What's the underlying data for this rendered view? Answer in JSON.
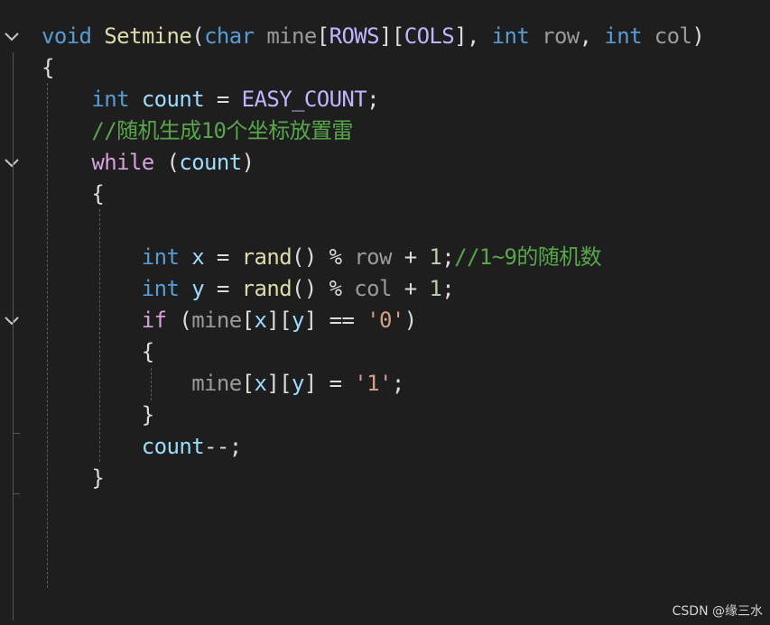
{
  "colors": {
    "background": "#1e1e1e",
    "keyword": "#569cd6",
    "control": "#d8a0df",
    "function": "#dcdcaa",
    "macro": "#beb7ff",
    "variable": "#9cdcfe",
    "comment": "#57a64a",
    "string": "#d69d85",
    "number": "#b5cea8",
    "plain": "#dcdcdc",
    "param": "#9a9a9a"
  },
  "code_lines": [
    {
      "tokens": [
        {
          "t": "void",
          "c": "keyword"
        },
        {
          "t": " ",
          "c": "plain"
        },
        {
          "t": "Setmine",
          "c": "function"
        },
        {
          "t": "(",
          "c": "plain"
        },
        {
          "t": "char",
          "c": "keyword"
        },
        {
          "t": " ",
          "c": "plain"
        },
        {
          "t": "mine",
          "c": "param"
        },
        {
          "t": "[",
          "c": "plain"
        },
        {
          "t": "ROWS",
          "c": "macro"
        },
        {
          "t": "][",
          "c": "plain"
        },
        {
          "t": "COLS",
          "c": "macro"
        },
        {
          "t": "], ",
          "c": "plain"
        },
        {
          "t": "int",
          "c": "keyword"
        },
        {
          "t": " ",
          "c": "plain"
        },
        {
          "t": "row",
          "c": "param"
        },
        {
          "t": ", ",
          "c": "plain"
        },
        {
          "t": "int",
          "c": "keyword"
        },
        {
          "t": " ",
          "c": "plain"
        },
        {
          "t": "col",
          "c": "param"
        },
        {
          "t": ")",
          "c": "plain"
        }
      ]
    },
    {
      "tokens": [
        {
          "t": "{",
          "c": "plain"
        }
      ]
    },
    {
      "tokens": [
        {
          "t": "    ",
          "c": "plain"
        },
        {
          "t": "int",
          "c": "keyword"
        },
        {
          "t": " ",
          "c": "plain"
        },
        {
          "t": "count",
          "c": "variable"
        },
        {
          "t": " = ",
          "c": "plain"
        },
        {
          "t": "EASY_COUNT",
          "c": "macro"
        },
        {
          "t": ";",
          "c": "plain"
        }
      ]
    },
    {
      "tokens": [
        {
          "t": "    ",
          "c": "plain"
        },
        {
          "t": "//随机生成10个坐标放置雷",
          "c": "comment"
        }
      ]
    },
    {
      "tokens": [
        {
          "t": "    ",
          "c": "plain"
        },
        {
          "t": "while",
          "c": "control"
        },
        {
          "t": " (",
          "c": "plain"
        },
        {
          "t": "count",
          "c": "variable"
        },
        {
          "t": ")",
          "c": "plain"
        }
      ]
    },
    {
      "tokens": [
        {
          "t": "    {",
          "c": "plain"
        }
      ]
    },
    {
      "tokens": []
    },
    {
      "tokens": [
        {
          "t": "        ",
          "c": "plain"
        },
        {
          "t": "int",
          "c": "keyword"
        },
        {
          "t": " ",
          "c": "plain"
        },
        {
          "t": "x",
          "c": "variable"
        },
        {
          "t": " = ",
          "c": "plain"
        },
        {
          "t": "rand",
          "c": "function"
        },
        {
          "t": "() % ",
          "c": "plain"
        },
        {
          "t": "row",
          "c": "param"
        },
        {
          "t": " + ",
          "c": "plain"
        },
        {
          "t": "1",
          "c": "number"
        },
        {
          "t": ";",
          "c": "plain"
        },
        {
          "t": "//1~9的随机数",
          "c": "comment"
        }
      ]
    },
    {
      "tokens": [
        {
          "t": "        ",
          "c": "plain"
        },
        {
          "t": "int",
          "c": "keyword"
        },
        {
          "t": " ",
          "c": "plain"
        },
        {
          "t": "y",
          "c": "variable"
        },
        {
          "t": " = ",
          "c": "plain"
        },
        {
          "t": "rand",
          "c": "function"
        },
        {
          "t": "() % ",
          "c": "plain"
        },
        {
          "t": "col",
          "c": "param"
        },
        {
          "t": " + ",
          "c": "plain"
        },
        {
          "t": "1",
          "c": "number"
        },
        {
          "t": ";",
          "c": "plain"
        }
      ]
    },
    {
      "tokens": [
        {
          "t": "        ",
          "c": "plain"
        },
        {
          "t": "if",
          "c": "control"
        },
        {
          "t": " (",
          "c": "plain"
        },
        {
          "t": "mine",
          "c": "param"
        },
        {
          "t": "[",
          "c": "plain"
        },
        {
          "t": "x",
          "c": "variable"
        },
        {
          "t": "][",
          "c": "plain"
        },
        {
          "t": "y",
          "c": "variable"
        },
        {
          "t": "] == ",
          "c": "plain"
        },
        {
          "t": "'0'",
          "c": "string"
        },
        {
          "t": ")",
          "c": "plain"
        }
      ]
    },
    {
      "tokens": [
        {
          "t": "        {",
          "c": "plain"
        }
      ]
    },
    {
      "tokens": [
        {
          "t": "            ",
          "c": "plain"
        },
        {
          "t": "mine",
          "c": "param"
        },
        {
          "t": "[",
          "c": "plain"
        },
        {
          "t": "x",
          "c": "variable"
        },
        {
          "t": "][",
          "c": "plain"
        },
        {
          "t": "y",
          "c": "variable"
        },
        {
          "t": "] = ",
          "c": "plain"
        },
        {
          "t": "'1'",
          "c": "string"
        },
        {
          "t": ";",
          "c": "plain"
        }
      ]
    },
    {
      "tokens": [
        {
          "t": "        }",
          "c": "plain"
        }
      ]
    },
    {
      "tokens": [
        {
          "t": "        ",
          "c": "plain"
        },
        {
          "t": "count",
          "c": "variable"
        },
        {
          "t": "--;",
          "c": "plain"
        }
      ]
    },
    {
      "tokens": [
        {
          "t": "    }",
          "c": "plain"
        }
      ]
    },
    {
      "tokens": []
    },
    {
      "tokens": []
    },
    {
      "tokens": []
    },
    {
      "tokens": []
    },
    {
      "tokens": [
        {
          "t": "}",
          "c": "plain"
        }
      ]
    }
  ],
  "fold_icons": [
    {
      "line": 0,
      "icon": "chevron-down-icon"
    },
    {
      "line": 4,
      "icon": "chevron-down-icon"
    },
    {
      "line": 9,
      "icon": "chevron-down-icon"
    }
  ],
  "watermark": "CSDN @缘三水"
}
